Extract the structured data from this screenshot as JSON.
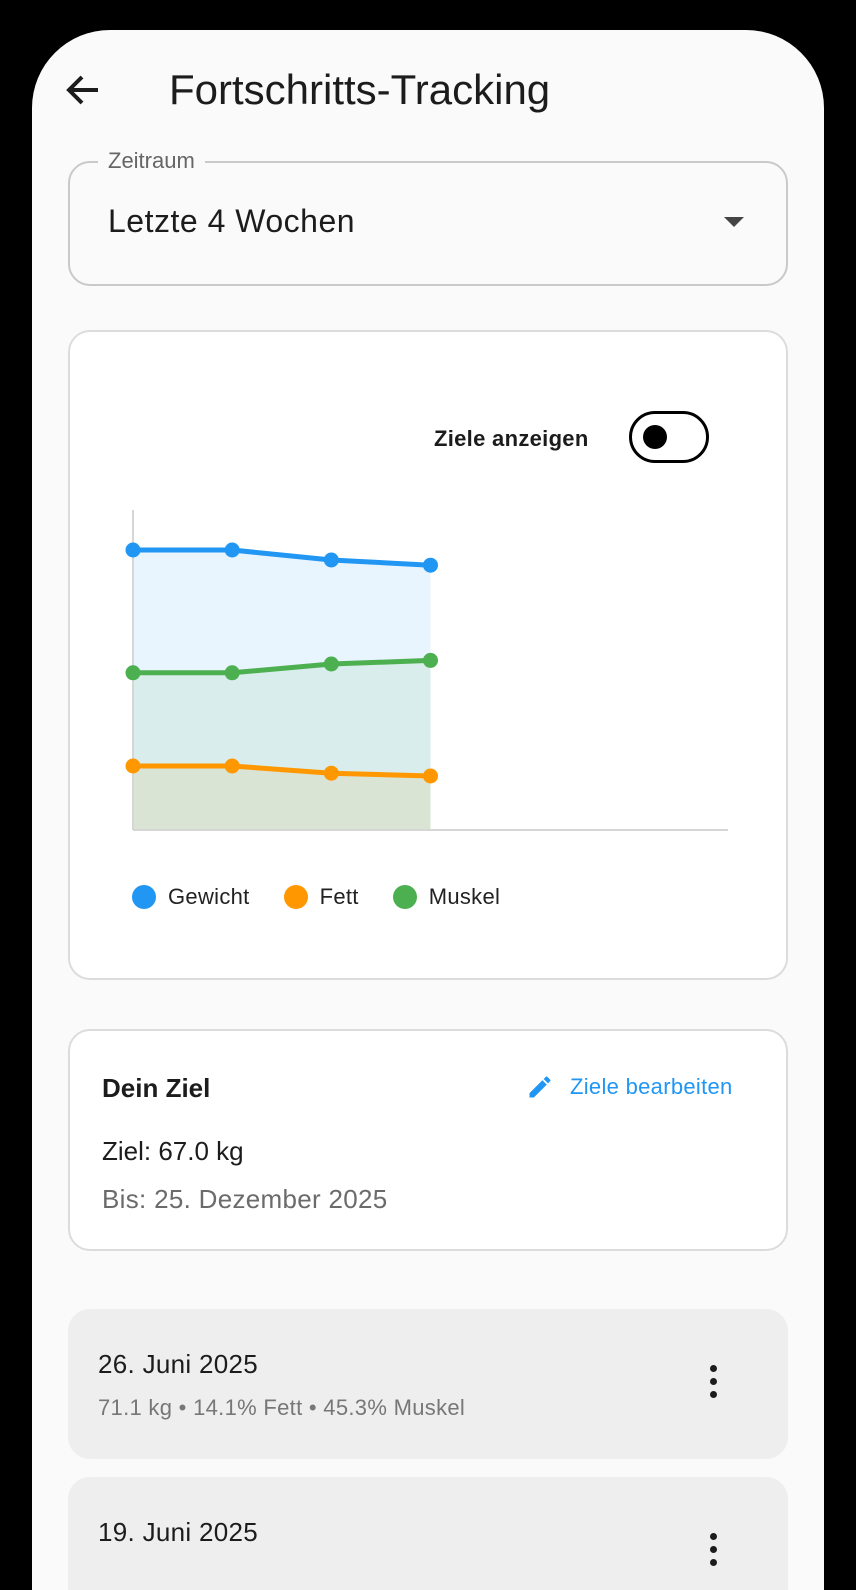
{
  "appbar": {
    "title": "Fortschritts-Tracking"
  },
  "period": {
    "label": "Zeitraum",
    "value": "Letzte 4 Wochen"
  },
  "chart_card": {
    "toggle_label": "Ziele anzeigen",
    "toggle_on": false
  },
  "chart_data": {
    "type": "area",
    "title": "",
    "xlabel": "",
    "ylabel": "",
    "grid": false,
    "legend_position": "bottom",
    "x": [
      1,
      2,
      3,
      4
    ],
    "xlim": [
      1,
      7
    ],
    "ylim": [
      0,
      80
    ],
    "series": [
      {
        "name": "Gewicht",
        "color": "#2196f3",
        "values": [
          70,
          70,
          67.5,
          66.2
        ]
      },
      {
        "name": "Fett",
        "color": "#ff9800",
        "values": [
          16,
          16,
          14.2,
          13.5
        ]
      },
      {
        "name": "Muskel",
        "color": "#4caf50",
        "values": [
          39.3,
          39.3,
          41.5,
          42.4
        ]
      }
    ]
  },
  "goal": {
    "title": "Dein Ziel",
    "edit_label": "Ziele bearbeiten",
    "target": "Ziel: 67.0 kg",
    "deadline": "Bis: 25. Dezember 2025"
  },
  "history": [
    {
      "date": "26. Juni 2025",
      "detail": "71.1 kg • 14.1% Fett • 45.3% Muskel"
    },
    {
      "date": "19. Juni 2025",
      "detail": ""
    }
  ],
  "colors": {
    "accent": "#2196f3",
    "gewicht": "#2196f3",
    "fett": "#ff9800",
    "muskel": "#4caf50"
  }
}
